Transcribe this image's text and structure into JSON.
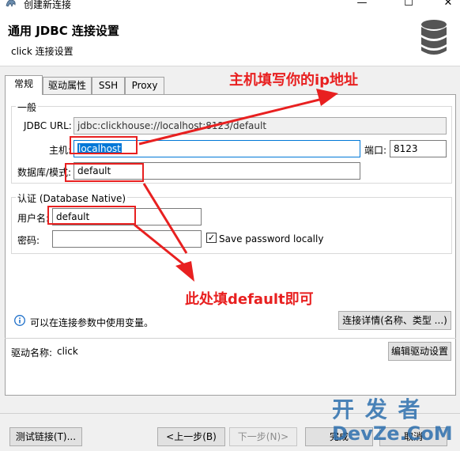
{
  "window": {
    "title": "创建新连接"
  },
  "header": {
    "title": "通用 JDBC 连接设置",
    "subtitle": "click 连接设置"
  },
  "tabs": [
    {
      "label": "常规"
    },
    {
      "label": "驱动属性"
    },
    {
      "label": "SSH"
    },
    {
      "label": "Proxy"
    }
  ],
  "general": {
    "group_title": "一般",
    "jdbc_url_label": "JDBC URL:",
    "jdbc_url_value": "jdbc:clickhouse://localhost:8123/default",
    "host_label": "主机:",
    "host_value": "localhost",
    "port_label": "端口:",
    "port_value": "8123",
    "db_label": "数据库/模式:",
    "db_value": "default"
  },
  "auth": {
    "group_title": "认证 (Database Native)",
    "username_label": "用户名:",
    "username_value": "default",
    "password_label": "密码:",
    "password_value": "",
    "save_password_label": "Save password locally",
    "save_password_checked": true
  },
  "info": {
    "text": "可以在连接参数中使用变量。",
    "details_button": "连接详情(名称、类型 ...)"
  },
  "driver": {
    "label": "驱动名称:",
    "value": "click",
    "edit_button": "编辑驱动设置"
  },
  "footer": {
    "test_button": "测试链接(T)...",
    "back_button": "<上一步(B)",
    "next_button": "下一步(N)>",
    "finish_button": "完成",
    "cancel_button": "取消"
  },
  "annotations": {
    "host_hint": "主机填写你的ip地址",
    "default_hint": "此处填default即可"
  },
  "watermark": {
    "line1": "开 发 者",
    "line2": "DevZe.CoM"
  },
  "colors": {
    "annotation": "#e82020",
    "accent": "#0078d7",
    "watermark": "#2d6fae"
  }
}
